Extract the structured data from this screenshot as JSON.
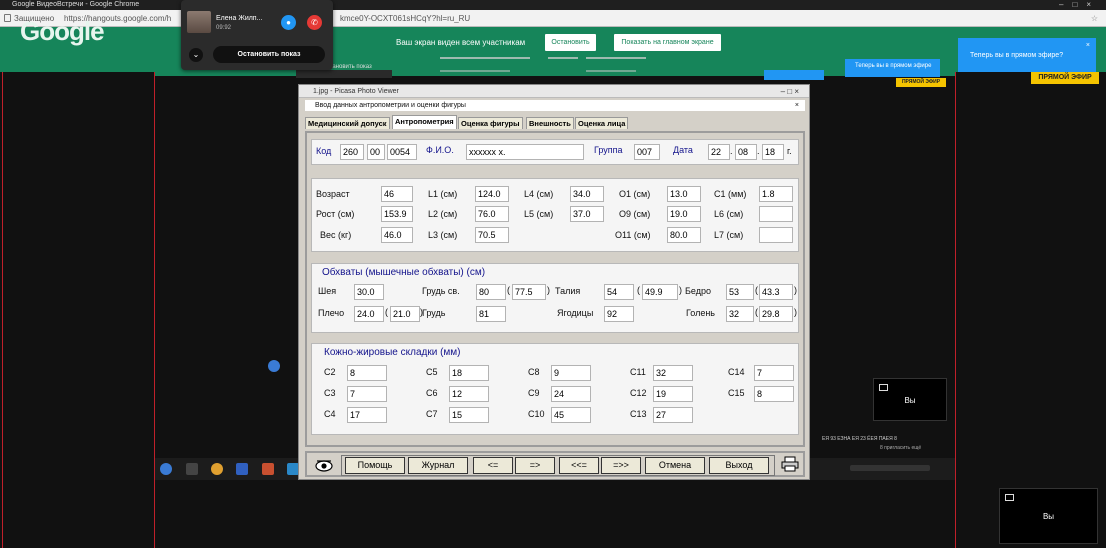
{
  "chrome": {
    "title": "Google ВидеоВстречи - Google Chrome",
    "secure": "Защищено",
    "url": "https://hangouts.google.com/h",
    "url_tail": "kmce0Y-OCXT061sHCqY?hl=ru_RU"
  },
  "meet": {
    "logo": "Google",
    "banner_message": "Ваш экран виден всем участникам",
    "stop_button": "Остановить",
    "show_main_button": "Показать на главном экране"
  },
  "hangout": {
    "name": "Елена   Жилп...",
    "time": "09:92",
    "stop_show": "Остановить показ",
    "ghost_stop_show": "Остановить показ"
  },
  "popup": {
    "text": "Теперь вы в прямом эфире?",
    "close": "×",
    "ghost_text": "Теперь вы в прямом эфире",
    "live_button": "ПРЯМОЙ ЭФИР"
  },
  "you_tiles": {
    "small": "Вы",
    "large": "Вы"
  },
  "taskbar_text": {
    "tray": "ЕЯ 93 ЕЗНА ЕЯ 23 ЁЕЯ ПАЕЯ 8",
    "tray2": "8 пригласить ещё"
  },
  "picasa": {
    "title": "1.jpg - Picasa Photo Viewer",
    "controls": "–  □  ×",
    "app_title": "Ввод данных антропометрии и оценки фигуры",
    "app_close": "×"
  },
  "tabs": [
    "Медицинский допуск",
    "Антропометрия",
    "Оценка фигуры",
    "Внешность",
    "Оценка лица"
  ],
  "header": {
    "kod_label": "Код",
    "kod": [
      "260",
      "00",
      "0054"
    ],
    "fio_label": "Ф.И.О.",
    "fio": "хххххх х.",
    "group_label": "Группа",
    "group": "007",
    "date_label": "Дата",
    "date": [
      "22",
      "08",
      "18"
    ],
    "date_sep": ".",
    "year_suffix": "г."
  },
  "anthro": {
    "rows": [
      {
        "label": "Возраст",
        "value": "46"
      },
      {
        "label": "Рост (см)",
        "value": "153.9"
      },
      {
        "label": "Вес (кг)",
        "value": "46.0"
      }
    ],
    "L": [
      {
        "label": "L1 (см)",
        "value": "124.0"
      },
      {
        "label": "L2 (см)",
        "value": "76.0"
      },
      {
        "label": "L3 (см)",
        "value": "70.5"
      }
    ],
    "L4": {
      "label": "L4 (см)",
      "value": "34.0"
    },
    "L5": {
      "label": "L5 (см)",
      "value": "37.0"
    },
    "O": [
      {
        "label": "O1 (см)",
        "value": "13.0"
      },
      {
        "label": "O9 (см)",
        "value": "19.0"
      },
      {
        "label": "O11 (см)",
        "value": "80.0"
      }
    ],
    "C": [
      {
        "label": "C1 (мм)",
        "value": "1.8"
      },
      {
        "label": "L6 (см)",
        "value": ""
      },
      {
        "label": "L7 (см)",
        "value": ""
      }
    ]
  },
  "girth": {
    "title": "Обхваты (мышечные обхваты) (см)",
    "neck": {
      "label": "Шея",
      "value": "30.0"
    },
    "chest_sv": {
      "label": "Грудь св.",
      "value": "80",
      "paren": "77.5"
    },
    "waist": {
      "label": "Талия",
      "value": "54",
      "paren": "49.9"
    },
    "hip": {
      "label": "Бедро",
      "value": "53",
      "paren": "43.3"
    },
    "shoulder": {
      "label": "Плечо",
      "value": "24.0",
      "paren": "21.0"
    },
    "chest": {
      "label": "Грудь",
      "value": "81"
    },
    "buttocks": {
      "label": "Ягодицы",
      "value": "92"
    },
    "shin": {
      "label": "Голень",
      "value": "32",
      "paren": "29.8"
    },
    "open_paren": "(",
    "close_paren": ")"
  },
  "skinfold": {
    "title": "Кожно-жировые складки (мм)",
    "items": [
      {
        "label": "C2",
        "value": "8"
      },
      {
        "label": "C3",
        "value": "7"
      },
      {
        "label": "C4",
        "value": "17"
      },
      {
        "label": "C5",
        "value": "18"
      },
      {
        "label": "C6",
        "value": "12"
      },
      {
        "label": "C7",
        "value": "15"
      },
      {
        "label": "C8",
        "value": "9"
      },
      {
        "label": "C9",
        "value": "24"
      },
      {
        "label": "C10",
        "value": "45"
      },
      {
        "label": "C11",
        "value": "32"
      },
      {
        "label": "C12",
        "value": "19"
      },
      {
        "label": "C13",
        "value": "27"
      },
      {
        "label": "C14",
        "value": "7"
      },
      {
        "label": "C15",
        "value": "8"
      }
    ]
  },
  "buttons": {
    "help": "Помощь",
    "journal": "Журнал",
    "prev": "<=",
    "next": "=>",
    "first": "<<=",
    "last": "=>>",
    "cancel": "Отмена",
    "exit": "Выход"
  },
  "colors": {
    "meet_green": "#16855a",
    "popup_blue": "#2196f3",
    "live_yellow": "#f5c400",
    "label_blue": "#14148c"
  }
}
